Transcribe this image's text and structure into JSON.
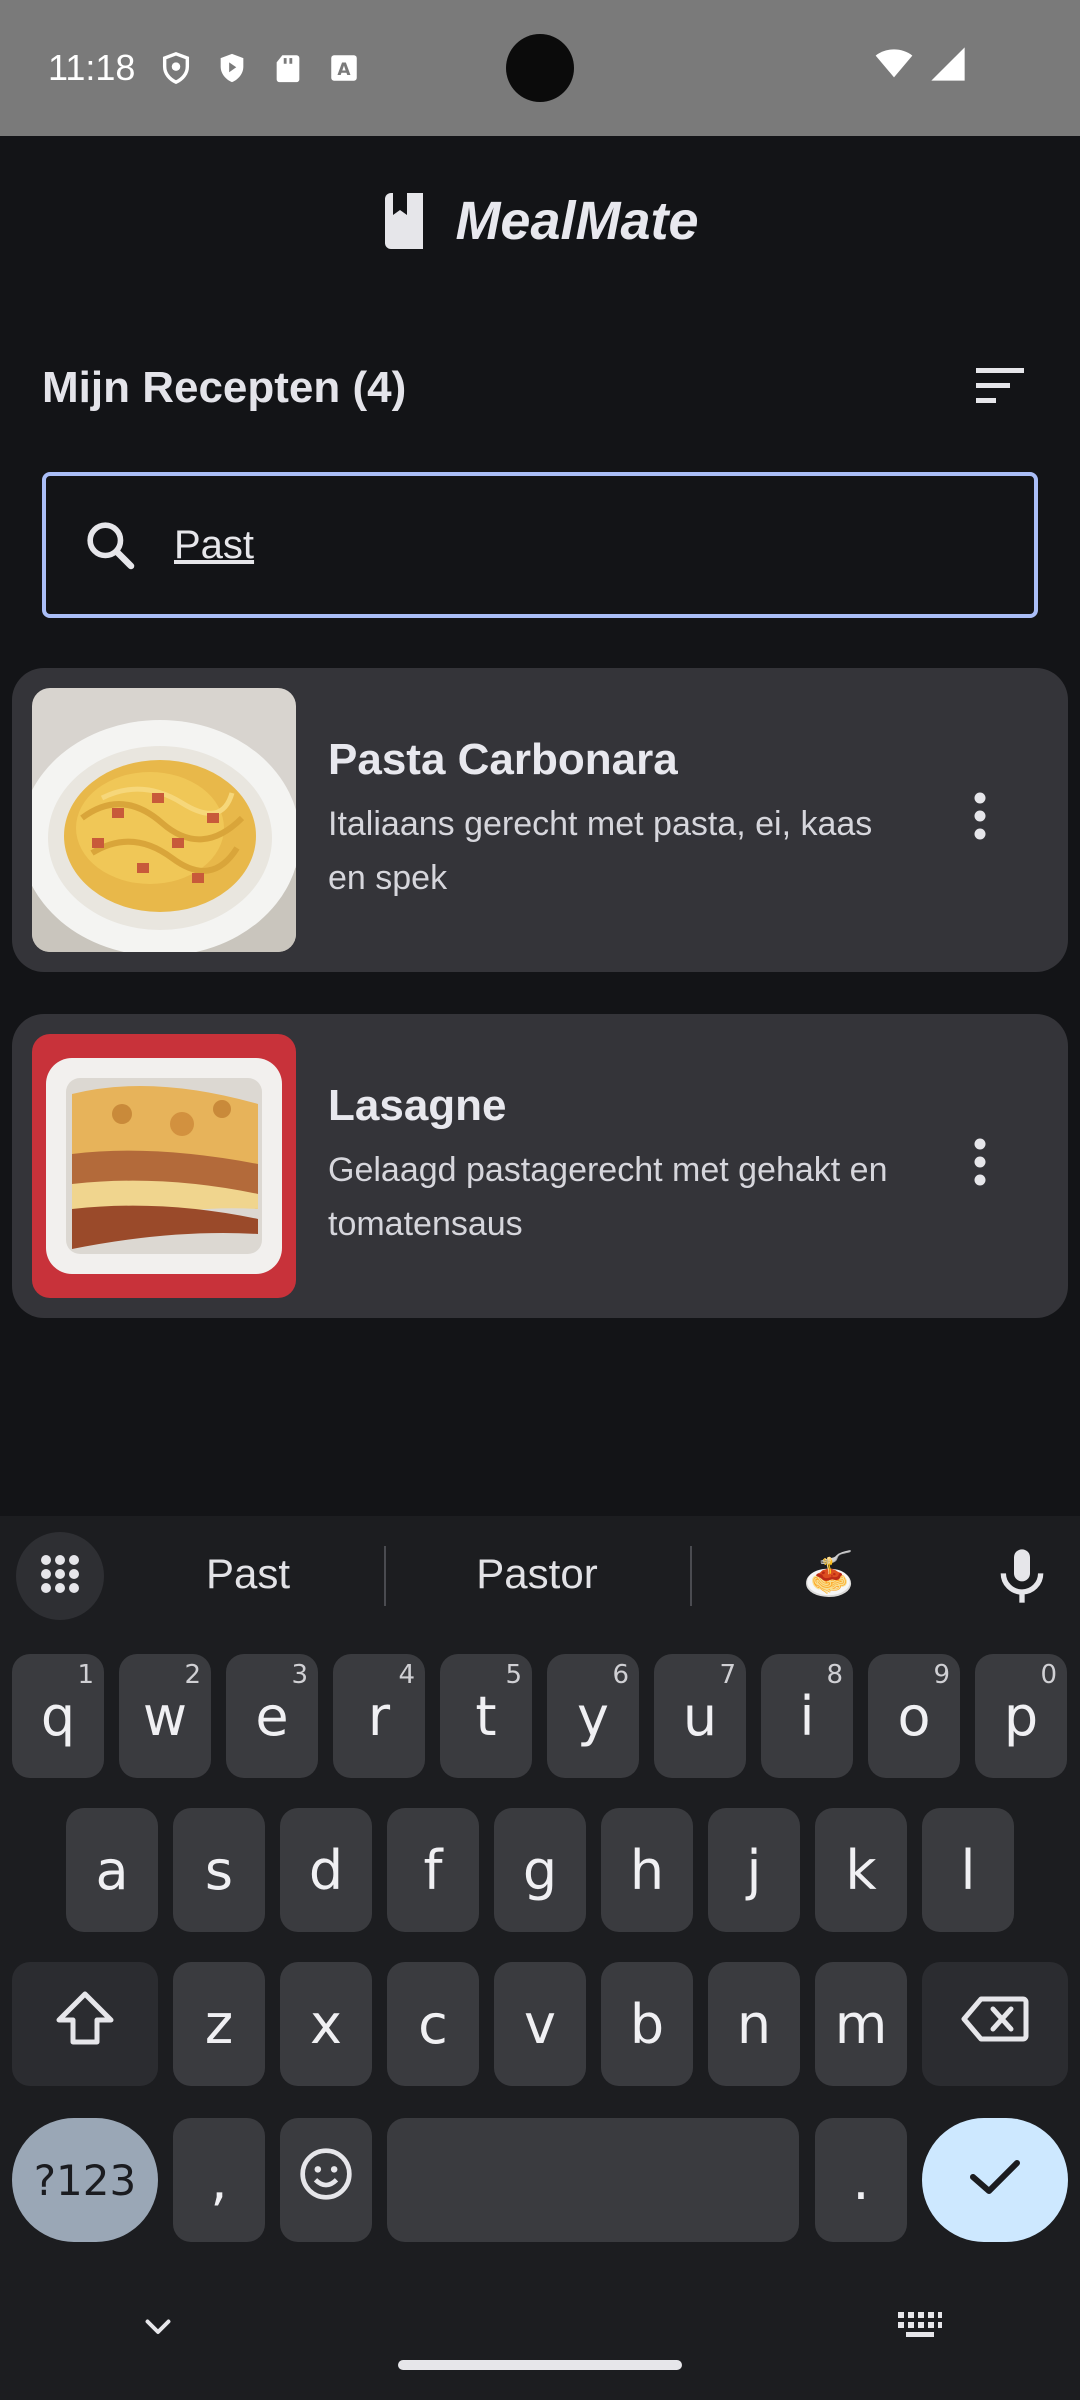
{
  "status_bar": {
    "time": "11:18",
    "icons": [
      "shield-icon",
      "play-protect-icon",
      "sd-card-icon",
      "a-box-icon"
    ],
    "right_icons": [
      "wifi-icon",
      "signal-icon"
    ]
  },
  "header": {
    "app_title": "MealMate",
    "logo_icon": "book-icon"
  },
  "section": {
    "title": "Mijn Recepten (4)",
    "sort_icon": "sort-icon"
  },
  "search": {
    "value": "Past",
    "icon": "search-icon"
  },
  "recipes": [
    {
      "name": "Pasta Carbonara",
      "description": "Italiaans gerecht met pasta, ei, kaas en spek",
      "image": "pasta-carbonara-photo"
    },
    {
      "name": "Lasagne",
      "description": "Gelaagd pastagerecht met gehakt en tomatensaus",
      "image": "lasagne-photo"
    }
  ],
  "keyboard": {
    "suggestions": [
      "Past",
      "Pastor",
      "🍝"
    ],
    "row1": [
      {
        "key": "q",
        "hint": "1"
      },
      {
        "key": "w",
        "hint": "2"
      },
      {
        "key": "e",
        "hint": "3"
      },
      {
        "key": "r",
        "hint": "4"
      },
      {
        "key": "t",
        "hint": "5"
      },
      {
        "key": "y",
        "hint": "6"
      },
      {
        "key": "u",
        "hint": "7"
      },
      {
        "key": "i",
        "hint": "8"
      },
      {
        "key": "o",
        "hint": "9"
      },
      {
        "key": "p",
        "hint": "0"
      }
    ],
    "row2": [
      "a",
      "s",
      "d",
      "f",
      "g",
      "h",
      "j",
      "k",
      "l"
    ],
    "row3": [
      "z",
      "x",
      "c",
      "v",
      "b",
      "n",
      "m"
    ],
    "symbols_label": "?123",
    "comma": ",",
    "period": "."
  },
  "colors": {
    "background": "#131417",
    "card": "#343439",
    "search_border": "#aabef7",
    "enter_key": "#cde8ff",
    "symbols_key": "#9aa7b6"
  }
}
